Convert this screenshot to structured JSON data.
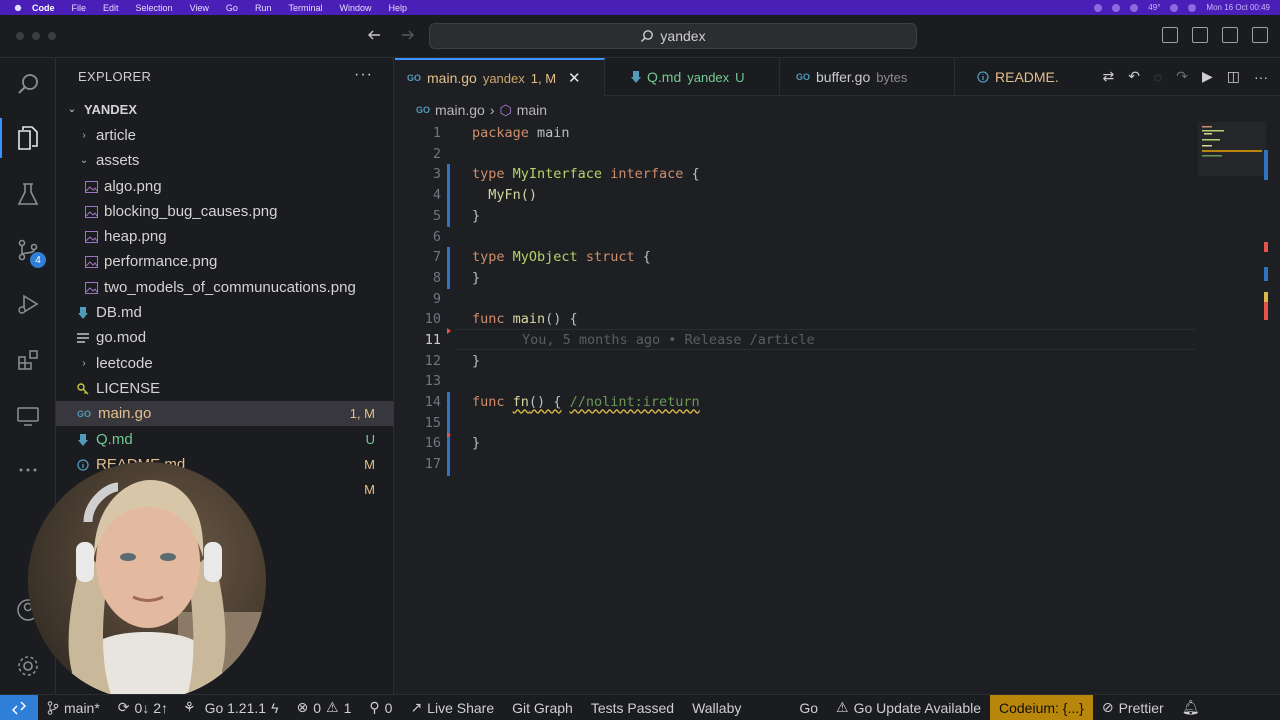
{
  "menubar": {
    "items": [
      "Code",
      "File",
      "Edit",
      "Selection",
      "View",
      "Go",
      "Run",
      "Terminal",
      "Window",
      "Help"
    ],
    "clock": "Mon 16 Oct 00:49",
    "temperature": "49°"
  },
  "titlebar": {
    "search_label": "yandex"
  },
  "activity": {
    "scm_badge": "4"
  },
  "explorer": {
    "header": "EXPLORER",
    "more": "···",
    "root": "YANDEX",
    "items": [
      {
        "label": "article",
        "kind": "folder-collapsed",
        "depth": 1,
        "status": ""
      },
      {
        "label": "assets",
        "kind": "folder-open",
        "depth": 1,
        "status": ""
      },
      {
        "label": "algo.png",
        "kind": "image",
        "depth": 2,
        "status": ""
      },
      {
        "label": "blocking_bug_causes.png",
        "kind": "image",
        "depth": 2,
        "status": ""
      },
      {
        "label": "heap.png",
        "kind": "image",
        "depth": 2,
        "status": ""
      },
      {
        "label": "performance.png",
        "kind": "image",
        "depth": 2,
        "status": ""
      },
      {
        "label": "two_models_of_communucations.png",
        "kind": "image",
        "depth": 2,
        "status": ""
      },
      {
        "label": "DB.md",
        "kind": "markdown",
        "depth": 1,
        "status": ""
      },
      {
        "label": "go.mod",
        "kind": "gomod",
        "depth": 1,
        "status": ""
      },
      {
        "label": "leetcode",
        "kind": "folder-collapsed",
        "depth": 1,
        "status": ""
      },
      {
        "label": "LICENSE",
        "kind": "license",
        "depth": 1,
        "status": ""
      },
      {
        "label": "main.go",
        "kind": "go",
        "depth": 1,
        "status": "1, M"
      },
      {
        "label": "Q.md",
        "kind": "markdown",
        "depth": 1,
        "status": "U"
      },
      {
        "label": "README.md",
        "kind": "info",
        "depth": 1,
        "status": "M"
      },
      {
        "label": "",
        "kind": "hidden",
        "depth": 1,
        "status": "M"
      }
    ]
  },
  "tabs": [
    {
      "label": "main.go",
      "desc": "yandex",
      "badge": "1, M",
      "active": true
    },
    {
      "label": "Q.md",
      "desc": "yandex",
      "badge": "U",
      "active": false
    },
    {
      "label": "buffer.go",
      "desc": "bytes",
      "badge": "",
      "active": false
    },
    {
      "label": "README.",
      "desc": "",
      "badge": "",
      "active": false
    }
  ],
  "breadcrumbs": {
    "file": "main.go",
    "symbol": "main"
  },
  "editor": {
    "lines": [
      {
        "n": "1",
        "text": "package main"
      },
      {
        "n": "2",
        "text": ""
      },
      {
        "n": "3",
        "text": "type MyInterface interface {"
      },
      {
        "n": "4",
        "text": "  MyFn()"
      },
      {
        "n": "5",
        "text": "}"
      },
      {
        "n": "6",
        "text": ""
      },
      {
        "n": "7",
        "text": "type MyObject struct {"
      },
      {
        "n": "8",
        "text": "}"
      },
      {
        "n": "9",
        "text": ""
      },
      {
        "n": "10",
        "text": "func main() {"
      },
      {
        "n": "11",
        "text": "    You, 5 months ago • Release /article"
      },
      {
        "n": "12",
        "text": "}"
      },
      {
        "n": "13",
        "text": ""
      },
      {
        "n": "14",
        "text": "func fn() { //nolint:ireturn"
      },
      {
        "n": "15",
        "text": ""
      },
      {
        "n": "16",
        "text": "}"
      },
      {
        "n": "17",
        "text": ""
      }
    ],
    "tokens": {
      "package": "package",
      "main": "main",
      "type": "type",
      "MyInterface": "MyInterface",
      "interface": "interface",
      "brace_open": " {",
      "MyFn": "MyFn()",
      "brace_close": "}",
      "MyObject": "MyObject",
      "struct": "struct",
      "func": "func",
      "main_fn": "main",
      "parens": "() {",
      "blame": "You, 5 months ago • Release /article",
      "fn": "fn",
      "fn_parens": "() {",
      "lint": "//nolint:ireturn"
    }
  },
  "statusbar": {
    "branch": "main*",
    "sync": "0↓ 2↑",
    "go_version": "Go 1.21.1",
    "errors": "0",
    "warnings": "1",
    "ports": "0",
    "live_share": "Live Share",
    "git_graph": "Git Graph",
    "tests": "Tests Passed",
    "wallaby": "Wallaby",
    "go": "Go",
    "go_update": "Go Update Available",
    "codeium": "Codeium: {...}",
    "prettier": "Prettier"
  },
  "colors": {
    "accent": "#3794ff",
    "modified": "#e2c08d",
    "untracked": "#73c991",
    "codeium": "#b8860b"
  }
}
